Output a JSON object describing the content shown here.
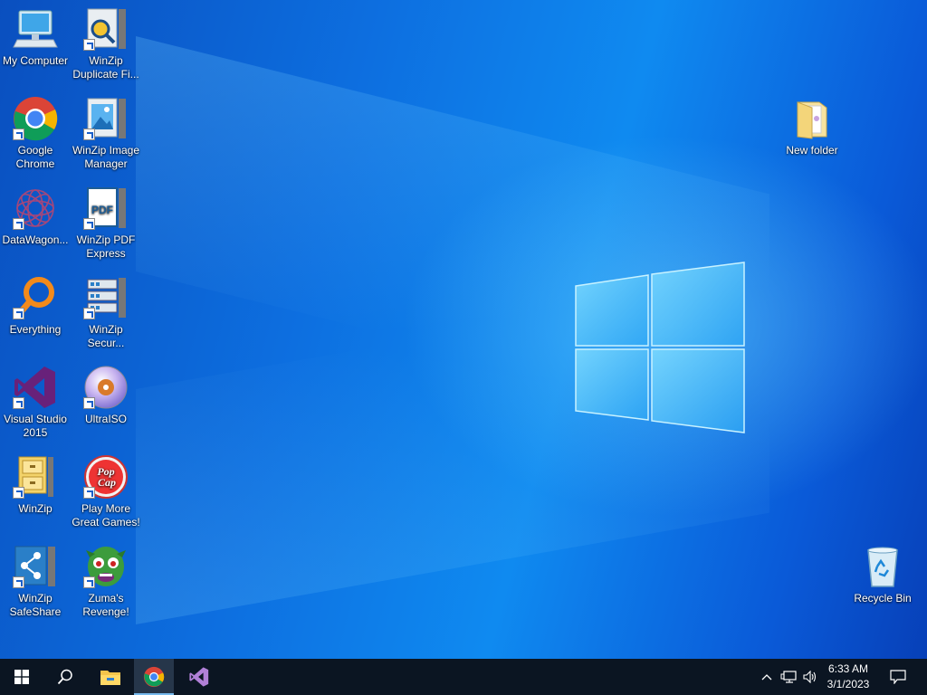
{
  "desktop": {
    "icons": [
      {
        "label": "My Computer",
        "icon": "computer-icon"
      },
      {
        "label": "WinZip Duplicate Fi...",
        "icon": "winzip-duplicate-icon"
      },
      {
        "label": "Google Chrome",
        "icon": "chrome-icon"
      },
      {
        "label": "WinZip Image Manager",
        "icon": "winzip-image-icon"
      },
      {
        "label": "DataWagon...",
        "icon": "datawagon-icon"
      },
      {
        "label": "WinZip PDF Express",
        "icon": "winzip-pdf-icon"
      },
      {
        "label": "Everything",
        "icon": "everything-icon"
      },
      {
        "label": "WinZip Secur...",
        "icon": "winzip-secure-icon"
      },
      {
        "label": "Visual Studio 2015",
        "icon": "visual-studio-icon"
      },
      {
        "label": "UltraISO",
        "icon": "ultraiso-icon"
      },
      {
        "label": "WinZip",
        "icon": "winzip-icon"
      },
      {
        "label": "Play More Great Games!",
        "icon": "popcap-icon"
      },
      {
        "label": "WinZip SafeShare",
        "icon": "winzip-safeshare-icon"
      },
      {
        "label": "Zuma's Revenge!",
        "icon": "zuma-icon"
      },
      {
        "label": "New folder",
        "icon": "folder-icon"
      },
      {
        "label": "Recycle Bin",
        "icon": "recycle-bin-icon"
      }
    ]
  },
  "taskbar": {
    "start_icon": "windows-start-icon",
    "search_icon": "search-icon",
    "pinned": [
      "file-explorer-icon",
      "chrome-icon",
      "visual-studio-icon"
    ],
    "active": "chrome-icon",
    "tray": [
      "chevron-up-icon",
      "network-icon",
      "volume-icon"
    ],
    "time": "6:33 AM",
    "date": "3/1/2023",
    "notification_icon": "action-center-icon"
  },
  "colors": {
    "desktop_blue": "#0d6fe0",
    "taskbar": "#0b1522",
    "accent": "#76b9ed"
  }
}
